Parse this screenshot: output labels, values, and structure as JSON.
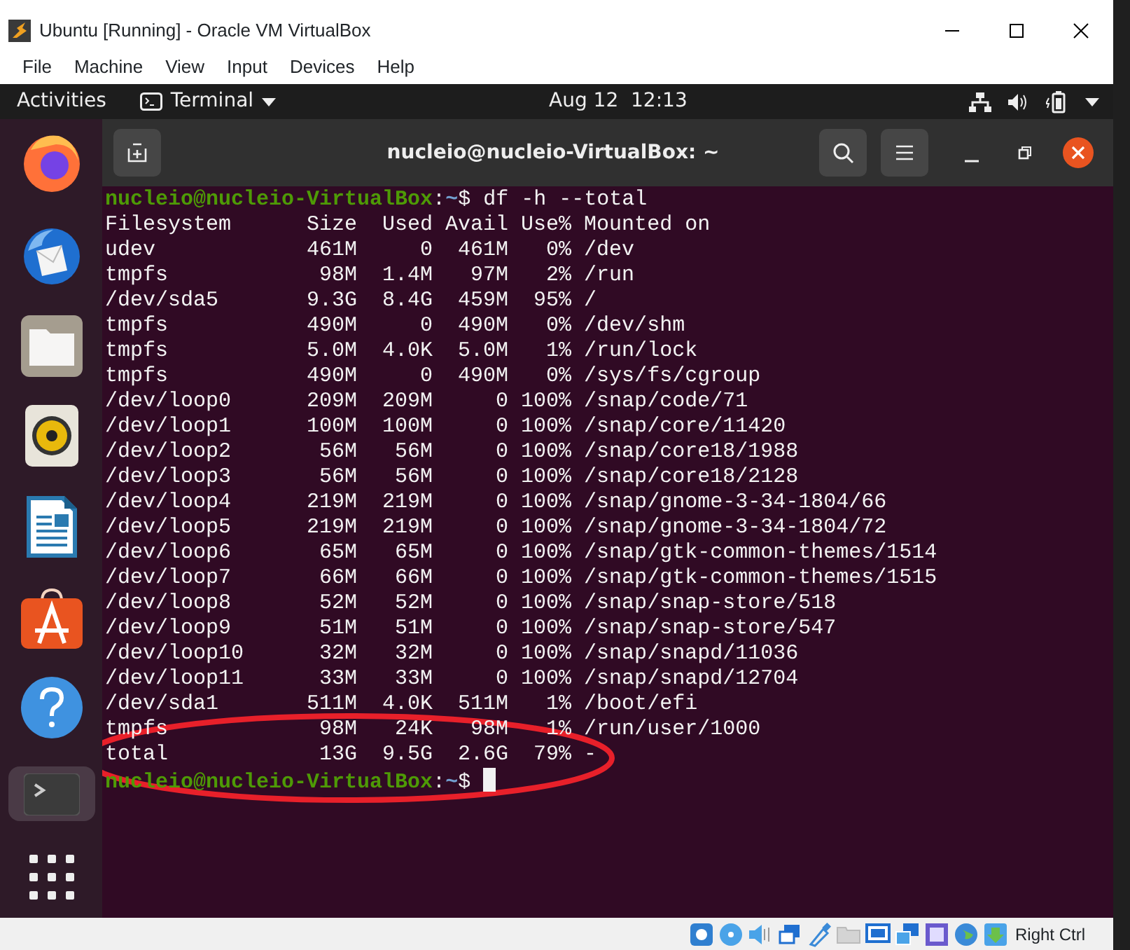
{
  "window": {
    "title": "Ubuntu [Running] - Oracle VM VirtualBox"
  },
  "menu": [
    "File",
    "Machine",
    "View",
    "Input",
    "Devices",
    "Help"
  ],
  "top_bar": {
    "activities": "Activities",
    "app": "Terminal",
    "date": "Aug 12",
    "time": "12:13"
  },
  "dock": [
    {
      "kind": "browser",
      "selected": false
    },
    {
      "kind": "mail",
      "selected": false
    },
    {
      "kind": "files",
      "selected": false
    },
    {
      "kind": "music",
      "selected": false
    },
    {
      "kind": "writer",
      "selected": false
    },
    {
      "kind": "store",
      "selected": false
    },
    {
      "kind": "help",
      "selected": false
    },
    {
      "kind": "terminal",
      "selected": true
    },
    {
      "kind": "apps",
      "selected": false
    }
  ],
  "terminal": {
    "title": "nucleio@nucleio-VirtualBox: ~",
    "lines": [
      {
        "kind": "prompt",
        "user": "nucleio@nucleio-VirtualBox",
        "colon": ":",
        "path": "~",
        "sign": "$",
        "command": "df -h --total",
        "cursor": false
      },
      {
        "kind": "output",
        "text": "Filesystem      Size  Used Avail Use% Mounted on"
      },
      {
        "kind": "output",
        "text": "udev            461M     0  461M   0% /dev"
      },
      {
        "kind": "output",
        "text": "tmpfs            98M  1.4M   97M   2% /run"
      },
      {
        "kind": "output",
        "text": "/dev/sda5       9.3G  8.4G  459M  95% /"
      },
      {
        "kind": "output",
        "text": "tmpfs           490M     0  490M   0% /dev/shm"
      },
      {
        "kind": "output",
        "text": "tmpfs           5.0M  4.0K  5.0M   1% /run/lock"
      },
      {
        "kind": "output",
        "text": "tmpfs           490M     0  490M   0% /sys/fs/cgroup"
      },
      {
        "kind": "output",
        "text": "/dev/loop0      209M  209M     0 100% /snap/code/71"
      },
      {
        "kind": "output",
        "text": "/dev/loop1      100M  100M     0 100% /snap/core/11420"
      },
      {
        "kind": "output",
        "text": "/dev/loop2       56M   56M     0 100% /snap/core18/1988"
      },
      {
        "kind": "output",
        "text": "/dev/loop3       56M   56M     0 100% /snap/core18/2128"
      },
      {
        "kind": "output",
        "text": "/dev/loop4      219M  219M     0 100% /snap/gnome-3-34-1804/66"
      },
      {
        "kind": "output",
        "text": "/dev/loop5      219M  219M     0 100% /snap/gnome-3-34-1804/72"
      },
      {
        "kind": "output",
        "text": "/dev/loop6       65M   65M     0 100% /snap/gtk-common-themes/1514"
      },
      {
        "kind": "output",
        "text": "/dev/loop7       66M   66M     0 100% /snap/gtk-common-themes/1515"
      },
      {
        "kind": "output",
        "text": "/dev/loop8       52M   52M     0 100% /snap/snap-store/518"
      },
      {
        "kind": "output",
        "text": "/dev/loop9       51M   51M     0 100% /snap/snap-store/547"
      },
      {
        "kind": "output",
        "text": "/dev/loop10      32M   32M     0 100% /snap/snapd/11036"
      },
      {
        "kind": "output",
        "text": "/dev/loop11      33M   33M     0 100% /snap/snapd/12704"
      },
      {
        "kind": "output",
        "text": "/dev/sda1       511M  4.0K  511M   1% /boot/efi"
      },
      {
        "kind": "output",
        "text": "tmpfs            98M   24K   98M   1% /run/user/1000"
      },
      {
        "kind": "output",
        "text": "total            13G  9.5G  2.6G  79% -"
      },
      {
        "kind": "prompt",
        "user": "nucleio@nucleio-VirtualBox",
        "colon": ":",
        "path": "~",
        "sign": "$",
        "cursor": true
      }
    ]
  },
  "annotations": [
    {
      "kind": "ellipse"
    }
  ],
  "status_bar": {
    "host_key": "Right Ctrl"
  }
}
